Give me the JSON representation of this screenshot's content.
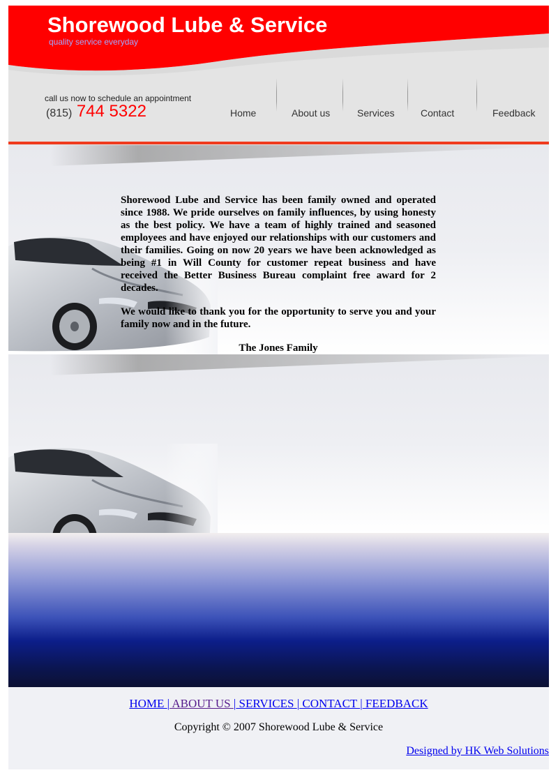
{
  "header": {
    "title": "Shorewood Lube & Service",
    "tagline": "quality service everyday",
    "call_text": "call us now to schedule an appointment",
    "phone_area": "(815)",
    "phone_number": "744 5322"
  },
  "nav": {
    "home": "Home",
    "about": "About us",
    "services": "Services",
    "contact": "Contact",
    "feedback": "Feedback"
  },
  "content": {
    "paragraph1": "Shorewood Lube and Service has been family owned and operated since 1988. We pride ourselves on family influences, by using honesty as the best policy. We have a team of highly trained and seasoned employees and have enjoyed our relationships with our customers and their families. Going on now 20 years we have been acknowledged as being #1 in Will County for customer repeat business and have received the Better Business Bureau complaint free award for 2 decades.",
    "paragraph2": "We would like to thank you for the opportunity to serve you and your family now and in the future.",
    "signature": "The Jones Family"
  },
  "footer": {
    "link_home": "HOME ",
    "sep1": "|",
    "link_about": " ABOUT US ",
    "sep2": "|",
    "link_services": " SERVICES ",
    "sep3": "|",
    "link_contact": " CONTACT ",
    "sep4": "|",
    "link_feedback": " FEEDBACK",
    "copyright": "Copyright © 2007 Shorewood Lube & Service",
    "designer": "Designed by HK Web Solutions"
  },
  "colors": {
    "brand_red": "#ff0000",
    "rule_red": "#ef3a1e",
    "link_blue": "#0000ee",
    "visited_purple": "#551a8b",
    "deep_blue": "#0c1e8a"
  }
}
